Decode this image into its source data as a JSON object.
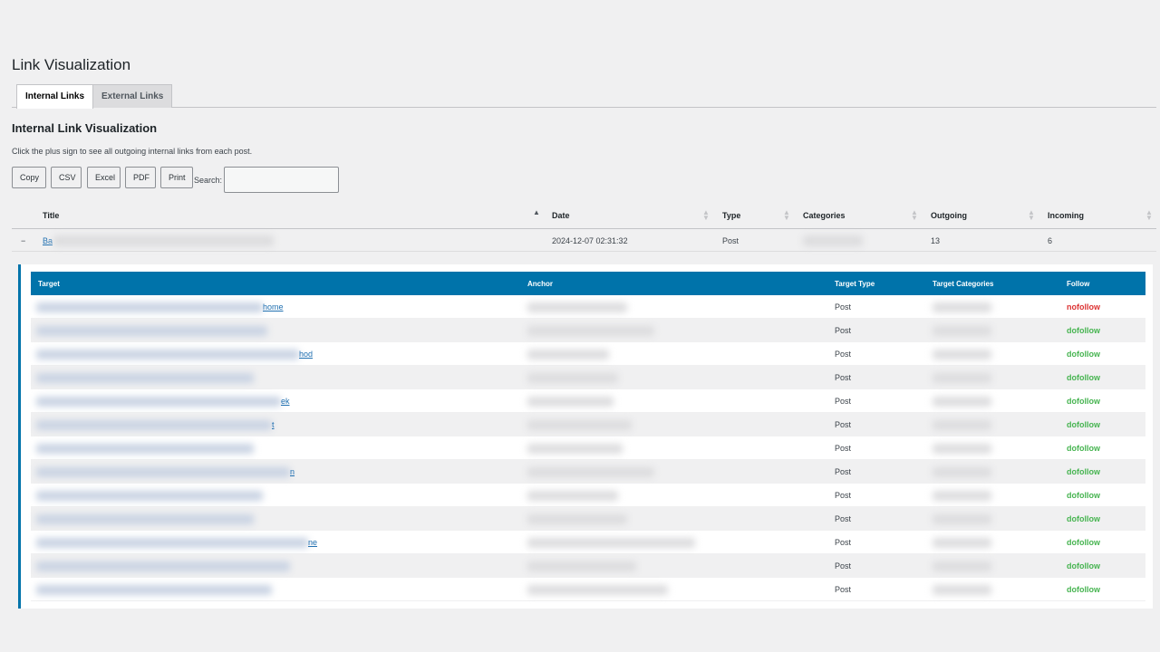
{
  "page": {
    "title": "Link Visualization"
  },
  "tabs": [
    {
      "label": "Internal Links",
      "active": true
    },
    {
      "label": "External Links",
      "active": false
    }
  ],
  "section": {
    "title": "Internal Link Visualization",
    "description": "Click the plus sign to see all outgoing internal links from each post."
  },
  "toolbar": {
    "buttons": [
      "Copy",
      "CSV",
      "Excel",
      "PDF",
      "Print"
    ],
    "search_label": "Search:",
    "search_value": ""
  },
  "main_table": {
    "columns": [
      "Title",
      "Date",
      "Type",
      "Categories",
      "Outgoing",
      "Incoming"
    ],
    "row": {
      "toggle": "−",
      "title_visible": "Ba",
      "date": "2024-12-07 02:31:32",
      "type": "Post",
      "outgoing": "13",
      "incoming": "6"
    }
  },
  "child_table": {
    "columns": [
      "Target",
      "Anchor",
      "Target Type",
      "Target Categories",
      "Follow"
    ],
    "rows": [
      {
        "target_tail": "home",
        "type": "Post",
        "follow": "nofollow"
      },
      {
        "target_tail": "",
        "type": "Post",
        "follow": "dofollow"
      },
      {
        "target_tail": "hod",
        "type": "Post",
        "follow": "dofollow"
      },
      {
        "target_tail": "",
        "type": "Post",
        "follow": "dofollow"
      },
      {
        "target_tail": "ek",
        "type": "Post",
        "follow": "dofollow"
      },
      {
        "target_tail": "t",
        "type": "Post",
        "follow": "dofollow"
      },
      {
        "target_tail": "",
        "type": "Post",
        "follow": "dofollow"
      },
      {
        "target_tail": "n",
        "type": "Post",
        "follow": "dofollow"
      },
      {
        "target_tail": "",
        "type": "Post",
        "follow": "dofollow"
      },
      {
        "target_tail": "",
        "type": "Post",
        "follow": "dofollow"
      },
      {
        "target_tail": "ne",
        "type": "Post",
        "follow": "dofollow"
      },
      {
        "target_tail": "",
        "type": "Post",
        "follow": "dofollow"
      },
      {
        "target_tail": "",
        "type": "Post",
        "follow": "dofollow"
      }
    ]
  },
  "colors": {
    "accent": "#0073aa",
    "dofollow": "#46b450",
    "nofollow": "#dc3232"
  }
}
